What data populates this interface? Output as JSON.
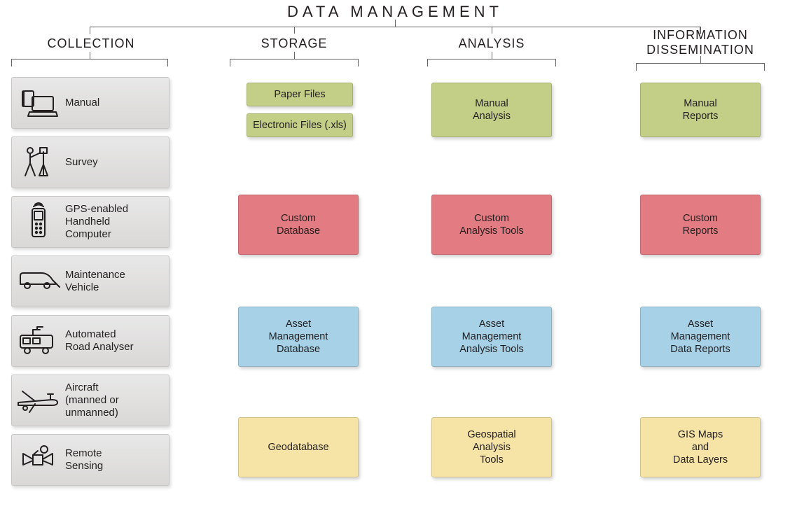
{
  "title": "DATA  MANAGEMENT",
  "headers": {
    "collection": "COLLECTION",
    "storage": "STORAGE",
    "analysis": "ANALYSIS",
    "dissemination": "INFORMATION\nDISSEMINATION"
  },
  "collection": [
    {
      "label": "Manual",
      "icon": "laptop"
    },
    {
      "label": "Survey",
      "icon": "surveyor"
    },
    {
      "label": "GPS-enabled\nHandheld\nComputer",
      "icon": "handheld"
    },
    {
      "label": "Maintenance\nVehicle",
      "icon": "van"
    },
    {
      "label": "Automated\nRoad Analyser",
      "icon": "roadvan"
    },
    {
      "label": "Aircraft\n(manned or\nunmanned)",
      "icon": "aircraft"
    },
    {
      "label": "Remote\nSensing",
      "icon": "satellite"
    }
  ],
  "storage": {
    "paper": "Paper Files",
    "xls": "Electronic Files (.xls)",
    "custom": "Custom\nDatabase",
    "asset": "Asset\nManagement\nDatabase",
    "geo": "Geodatabase"
  },
  "analysis": {
    "manual": "Manual\nAnalysis",
    "custom": "Custom\nAnalysis Tools",
    "asset": "Asset\nManagement\nAnalysis Tools",
    "geo": "Geospatial\nAnalysis\nTools"
  },
  "dissemination": {
    "manual": "Manual\nReports",
    "custom": "Custom\nReports",
    "asset": "Asset\nManagement\nData Reports",
    "geo": "GIS Maps\nand\nData Layers"
  }
}
